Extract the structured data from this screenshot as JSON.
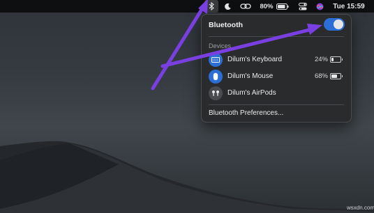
{
  "menubar": {
    "bluetooth_icon": "bluetooth-icon",
    "focus_icon": "moon-icon",
    "link_icon": "link-icon",
    "battery_percent": "80%",
    "clock": "Tue 15:59"
  },
  "panel": {
    "title": "Bluetooth",
    "bluetooth_on": true,
    "devices_label": "Devices",
    "devices": [
      {
        "name": "Dilum's Keyboard",
        "battery": "24%",
        "battery_level": 0.24,
        "icon": "keyboard-icon",
        "connected": true
      },
      {
        "name": "Dilum's Mouse",
        "battery": "68%",
        "battery_level": 0.68,
        "icon": "mouse-icon",
        "connected": true
      },
      {
        "name": "Dilum's AirPods",
        "battery": "",
        "icon": "airpods-icon",
        "connected": false
      }
    ],
    "preferences_label": "Bluetooth Preferences..."
  },
  "watermark": "wsxdn.com",
  "colors": {
    "accent": "#2d6dd6",
    "arrow": "#7a3fe0",
    "panel_bg": "#2a2b2d",
    "menubar_bg": "#0e0f10"
  }
}
